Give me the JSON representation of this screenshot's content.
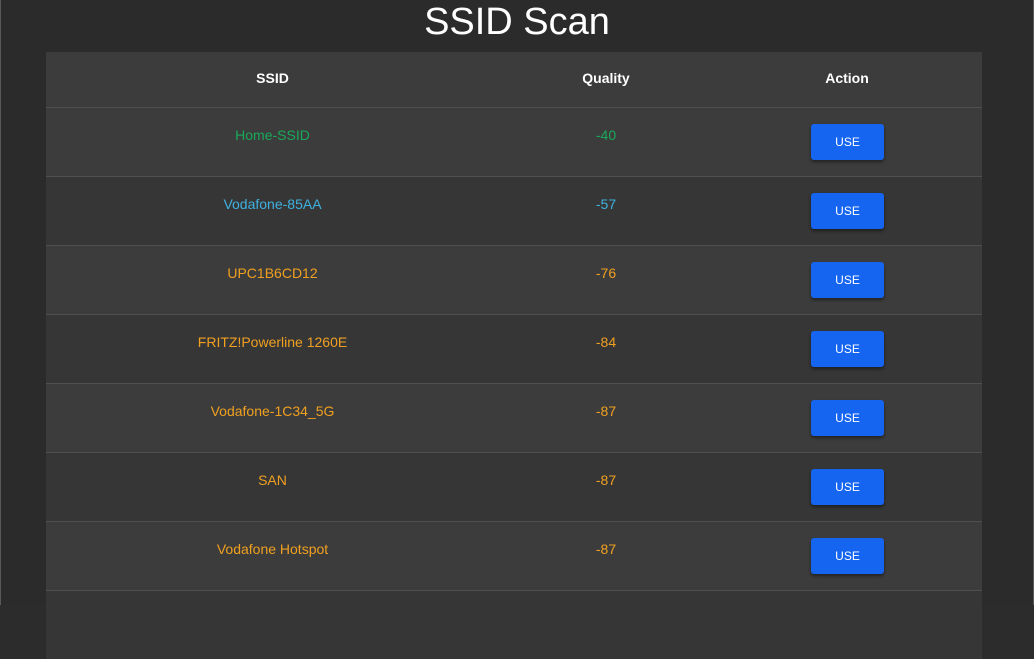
{
  "page": {
    "title": "SSID Scan"
  },
  "table": {
    "columns": [
      "SSID",
      "Quality",
      "Action"
    ],
    "rows": [
      {
        "ssid": "Home-SSID",
        "quality": "-40",
        "action": "USE",
        "color": "#19a95a"
      },
      {
        "ssid": "Vodafone-85AA",
        "quality": "-57",
        "action": "USE",
        "color": "#3fb1e0"
      },
      {
        "ssid": "UPC1B6CD12",
        "quality": "-76",
        "action": "USE",
        "color": "#f0a020"
      },
      {
        "ssid": "FRITZ!Powerline 1260E",
        "quality": "-84",
        "action": "USE",
        "color": "#f0a020"
      },
      {
        "ssid": "Vodafone-1C34_5G",
        "quality": "-87",
        "action": "USE",
        "color": "#f0a020"
      },
      {
        "ssid": "SAN",
        "quality": "-87",
        "action": "USE",
        "color": "#f0a020"
      },
      {
        "ssid": "Vodafone Hotspot",
        "quality": "-87",
        "action": "USE",
        "color": "#f0a020"
      }
    ]
  },
  "colors": {
    "button": "#1565f0",
    "background": "#2c2c2c"
  }
}
